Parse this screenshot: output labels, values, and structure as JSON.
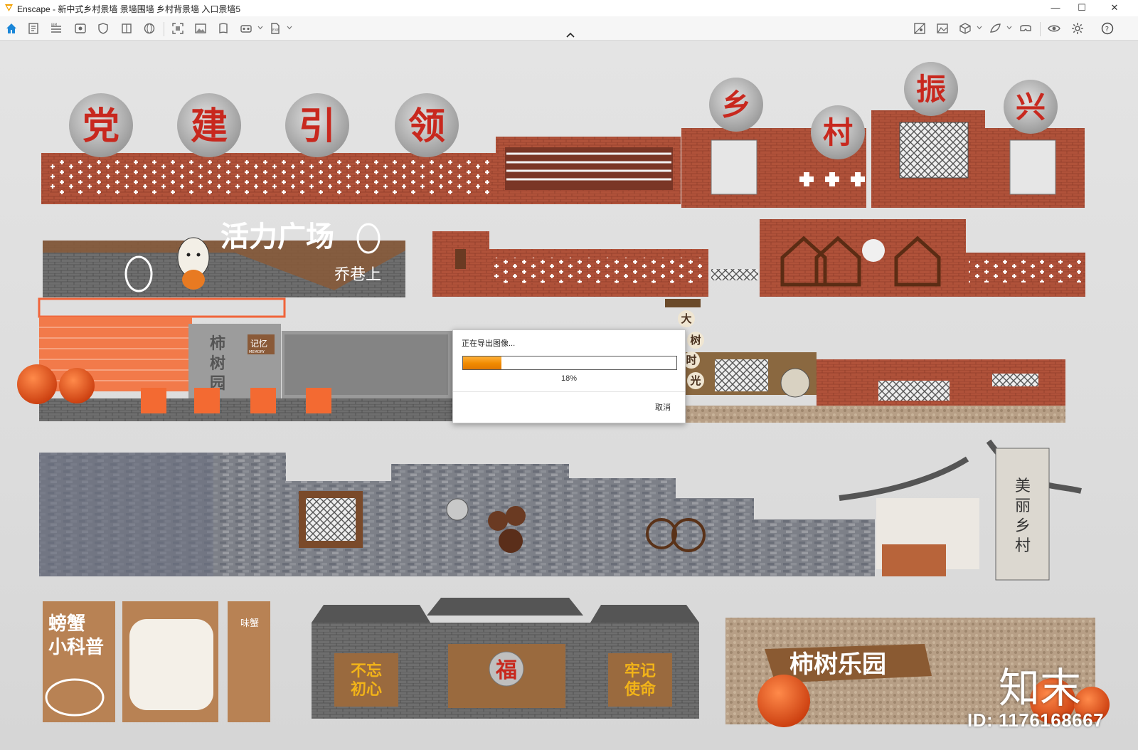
{
  "window": {
    "app_name": "Enscape",
    "title": "Enscape - 新中式乡村景墙 景墙围墙 乡村背景墙 入口景墙5",
    "controls": [
      "—",
      "☐",
      "✕"
    ]
  },
  "toolbar": {
    "left_icons": [
      "home-icon",
      "document-icon",
      "bim-icon",
      "view-icon",
      "shield-icon",
      "book-icon",
      "sphere-icon",
      "screenshot-icon",
      "image-icon",
      "panorama-icon",
      "vr-icon",
      "export-icon"
    ],
    "right_icons": [
      "asset-library-icon",
      "image-settings-icon",
      "cube-icon",
      "material-icon",
      "vr-headset-icon",
      "eye-icon",
      "settings-icon",
      "help-icon"
    ]
  },
  "scene": {
    "banner_top_left": [
      "党",
      "建",
      "引",
      "领"
    ],
    "banner_top_right": [
      "乡",
      "村",
      "振",
      "兴"
    ],
    "vitality_title": "活力广场",
    "vitality_sub": "乔巷上",
    "memory_sign": "记忆",
    "memory_sub": "MEMORY",
    "persimmon_garden_vertical": [
      "柿",
      "树",
      "园"
    ],
    "sign_vertical": [
      "大",
      "树",
      "时",
      "光"
    ],
    "beautiful_village": [
      "美",
      "丽",
      "乡",
      "村"
    ],
    "crab_title": [
      "螃蟹",
      "小科普"
    ],
    "crab_side": "味蟹",
    "gate_left": [
      "不忘",
      "初心"
    ],
    "gate_center": "福",
    "gate_right": [
      "牢记",
      "使命"
    ],
    "persimmon_park": "柿树乐园"
  },
  "export_dialog": {
    "title": "正在导出图像...",
    "progress": 0.18,
    "progress_text": "18%",
    "cancel_label": "取消"
  },
  "watermark": {
    "logo_text": "知末",
    "id_text": "ID: 1176168667"
  },
  "colors": {
    "brick": "#b0523a",
    "accent_orange": "#f08a00",
    "red_text": "#c8281e"
  }
}
